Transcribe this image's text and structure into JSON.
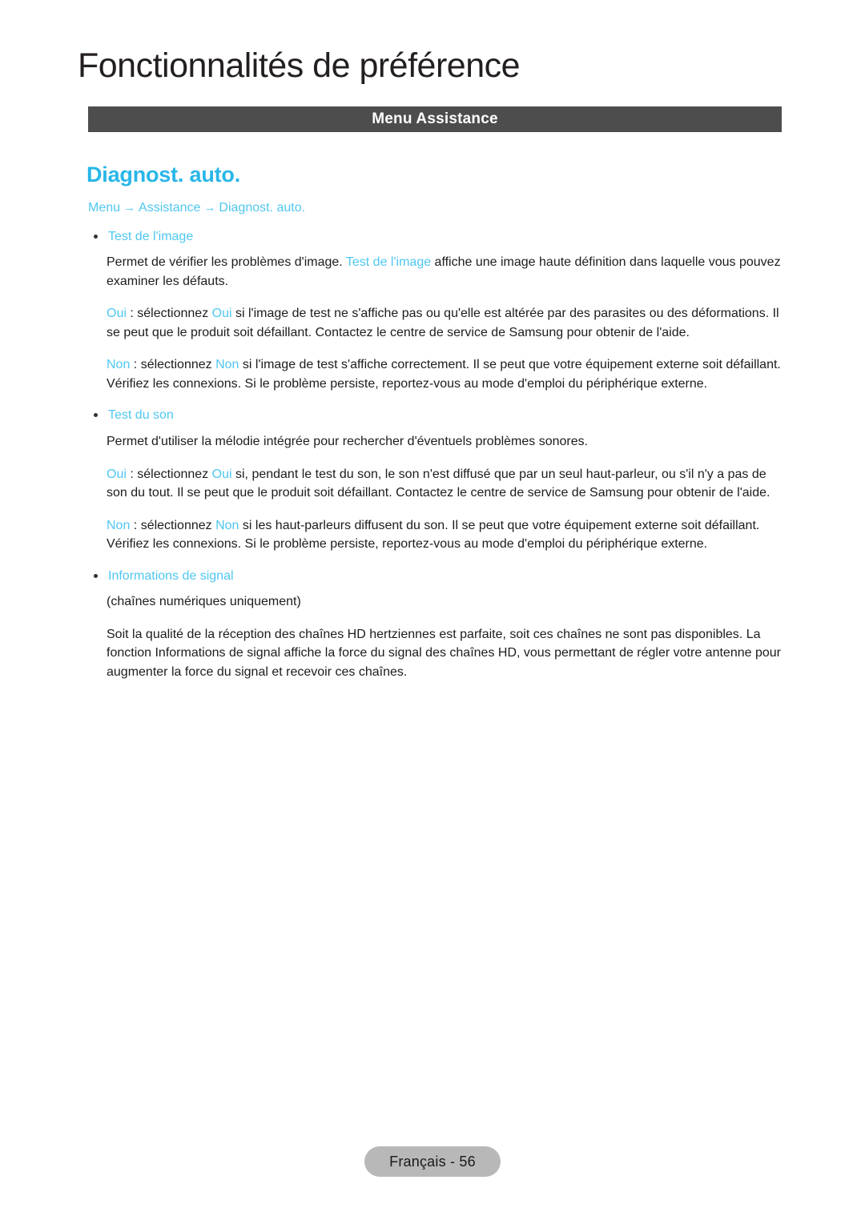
{
  "header": {
    "chapter_title": "Fonctionnalités de préférence",
    "section_banner": "Menu Assistance"
  },
  "feature": {
    "title": "Diagnost. auto.",
    "breadcrumb": {
      "items": [
        "Menu",
        "Assistance",
        "Diagnost. auto."
      ],
      "separator": "→"
    }
  },
  "sections": [
    {
      "bullet_label": "Test de l'image",
      "paragraphs": [
        {
          "parts": [
            {
              "text": "Permet de vérifier les problèmes d'image. ",
              "style": "normal"
            },
            {
              "text": "Test de l'image",
              "style": "highlight"
            },
            {
              "text": " affiche une image haute définition dans laquelle vous pouvez examiner les défauts.",
              "style": "normal"
            }
          ]
        },
        {
          "parts": [
            {
              "text": "Oui",
              "style": "highlight"
            },
            {
              "text": " : sélectionnez ",
              "style": "normal"
            },
            {
              "text": "Oui",
              "style": "highlight"
            },
            {
              "text": " si l'image de test ne s'affiche pas ou qu'elle est altérée par des parasites ou des déformations. Il se peut que le produit soit défaillant. Contactez le centre de service de Samsung pour obtenir de l'aide.",
              "style": "normal"
            }
          ]
        },
        {
          "parts": [
            {
              "text": "Non",
              "style": "highlight"
            },
            {
              "text": " : sélectionnez ",
              "style": "normal"
            },
            {
              "text": "Non",
              "style": "highlight"
            },
            {
              "text": " si l'image de test s'affiche correctement. Il se peut que votre équipement externe soit défaillant. Vérifiez les connexions. Si le problème persiste, reportez-vous au mode d'emploi du périphérique externe.",
              "style": "normal"
            }
          ]
        }
      ]
    },
    {
      "bullet_label": "Test du son",
      "paragraphs": [
        {
          "parts": [
            {
              "text": "Permet d'utiliser la mélodie intégrée pour rechercher d'éventuels problèmes sonores.",
              "style": "normal"
            }
          ]
        },
        {
          "parts": [
            {
              "text": "Oui",
              "style": "highlight"
            },
            {
              "text": " : sélectionnez ",
              "style": "normal"
            },
            {
              "text": "Oui",
              "style": "highlight"
            },
            {
              "text": " si, pendant le test du son, le son n'est diffusé que par un seul haut-parleur, ou s'il n'y a pas de son du tout. Il se peut que le produit soit défaillant. Contactez le centre de service de Samsung pour obtenir de l'aide.",
              "style": "normal"
            }
          ]
        },
        {
          "parts": [
            {
              "text": "Non",
              "style": "highlight"
            },
            {
              "text": " : sélectionnez ",
              "style": "normal"
            },
            {
              "text": "Non",
              "style": "highlight"
            },
            {
              "text": " si les haut-parleurs diffusent du son. Il se peut que votre équipement externe soit défaillant. Vérifiez les connexions. Si le problème persiste, reportez-vous au mode d'emploi du périphérique externe.",
              "style": "normal"
            }
          ]
        }
      ]
    },
    {
      "bullet_label": "Informations de signal",
      "paragraphs": [
        {
          "parts": [
            {
              "text": "(chaînes numériques uniquement)",
              "style": "normal"
            }
          ]
        },
        {
          "parts": [
            {
              "text": "Soit la qualité de la réception des chaînes HD hertziennes est parfaite, soit ces chaînes ne sont pas disponibles. La fonction Informations de signal affiche la force du signal des chaînes HD, vous permettant de régler votre antenne pour augmenter la force du signal et recevoir ces chaînes.",
              "style": "normal"
            }
          ]
        }
      ]
    }
  ],
  "footer": {
    "page_label": "Français - 56"
  },
  "colors": {
    "accent": "#4fc7f0",
    "heading_accent": "#29b6e8",
    "banner_bg": "#4d4d4d",
    "footer_bg": "#b8b8b8",
    "body_text": "#1c1c1c"
  }
}
